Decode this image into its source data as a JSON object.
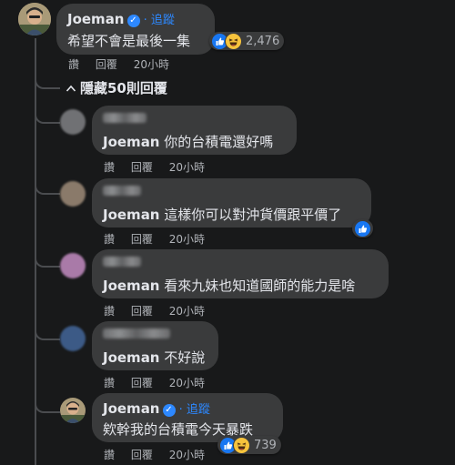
{
  "main_comment": {
    "author": "Joeman",
    "follow_label": "追蹤",
    "text": "希望不會是最後一集",
    "reaction_count": "2,476",
    "actions": {
      "like": "讚",
      "reply": "回覆",
      "time": "20小時"
    }
  },
  "hide_replies_label": "隱藏50則回覆",
  "replies": [
    {
      "mention": "Joeman",
      "text": " 你的台積電還好嗎",
      "like": "讚",
      "reply": "回覆",
      "time": "20小時"
    },
    {
      "mention": "Joeman",
      "text": " 這樣你可以對沖貨價跟平價了",
      "like": "讚",
      "reply": "回覆",
      "time": "20小時"
    },
    {
      "mention": "Joeman",
      "text": " 看來九妹也知道國師的能力是啥",
      "like": "讚",
      "reply": "回覆",
      "time": "20小時"
    },
    {
      "mention": "Joeman",
      "text": " 不好說",
      "like": "讚",
      "reply": "回覆",
      "time": "20小時"
    }
  ],
  "author_reply": {
    "author": "Joeman",
    "follow_label": "追蹤",
    "text": "欸幹我的台積電今天暴跌",
    "reaction_count": "739",
    "actions": {
      "like": "讚",
      "reply": "回覆",
      "time": "20小時"
    }
  },
  "colors": {
    "background": "#18191a",
    "bubble": "#3a3b3c",
    "link": "#2d88ff",
    "secondary_text": "#b0b3b8"
  },
  "icons": [
    "verified-badge-icon",
    "like-reaction-icon",
    "haha-reaction-icon",
    "chevron-up-icon"
  ]
}
